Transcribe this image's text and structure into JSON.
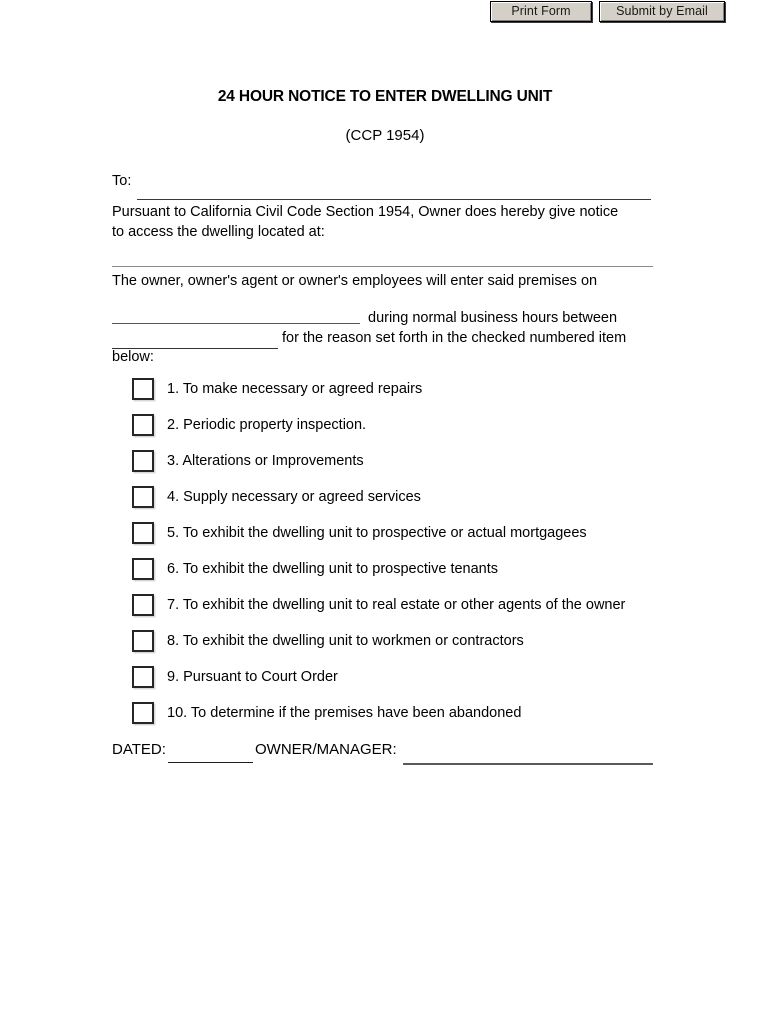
{
  "toolbar": {
    "print_label": "Print Form",
    "submit_label": "Submit by Email"
  },
  "document": {
    "title": "24 HOUR NOTICE TO ENTER DWELLING UNIT",
    "subtitle": "(CCP 1954)",
    "to_label": "To:",
    "intro_main": "Pursuant to California Civil Code Section 1954, Owner does hereby give notice",
    "intro_last": "to access the dwelling located at:",
    "entry_line_1": "The owner, owner's agent or owner's employees will enter said premises on",
    "entry_line_2": "during normal business hours between",
    "entry_line_3": "for the reason set forth in the checked numbered item",
    "entry_line_4": "below:"
  },
  "checklist": {
    "items": [
      {
        "label": "1. To make necessary or agreed repairs",
        "checked": false
      },
      {
        "label": "2. Periodic property inspection.",
        "checked": false
      },
      {
        "label": "3. Alterations or Improvements",
        "checked": false
      },
      {
        "label": "4. Supply necessary or agreed services",
        "checked": false
      },
      {
        "label": "5. To exhibit the dwelling unit to prospective or actual mortgagees",
        "checked": false
      },
      {
        "label": "6. To exhibit the dwelling unit to prospective tenants",
        "checked": false
      },
      {
        "label": "7. To exhibit the dwelling unit to real estate or other agents of the owner",
        "checked": false
      },
      {
        "label": "8. To exhibit the dwelling unit to workmen or contractors",
        "checked": false
      },
      {
        "label": "9. Pursuant to Court Order",
        "checked": false
      },
      {
        "label": "10. To determine if the premises have been abandoned",
        "checked": false
      }
    ]
  },
  "footer": {
    "dated_label": "DATED:",
    "owner_label": "OWNER/MANAGER:",
    "dated_value": "",
    "owner_value": ""
  },
  "colors": {
    "button_face": "#d4d0c8",
    "text": "#000000",
    "rule": "#5a5a5a"
  }
}
